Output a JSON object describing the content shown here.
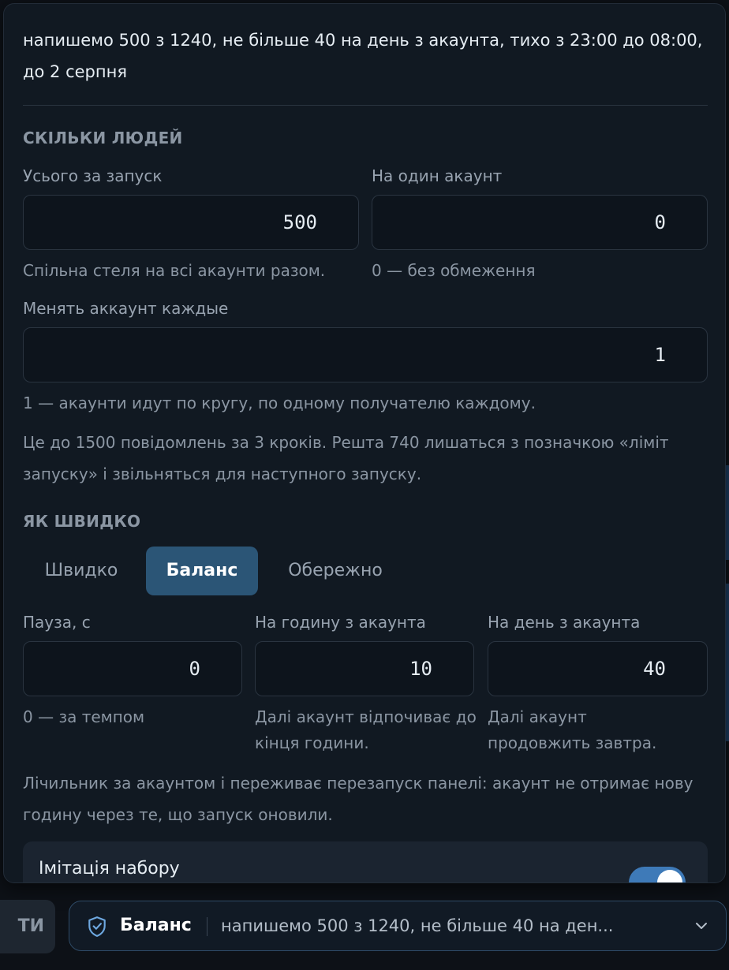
{
  "summary": "напишемо 500 з 1240, не більше 40 на день з акаунта, тихо з 23:00 до 08:00, до 2 серпня",
  "people": {
    "title": "СКІЛЬКИ ЛЮДЕЙ",
    "total_label": "Усього за запуск",
    "total_value": "500",
    "total_hint": "Спільна стеля на всі акаунти разом.",
    "per_account_label": "На один акаунт",
    "per_account_value": "0",
    "per_account_hint": "0 — без обмеження",
    "rotate_label": "Менять аккаунт каждые",
    "rotate_value": "1",
    "rotate_hint": "1 — акаунти идут по кругу, по одному получателю каждому.",
    "note": "Це до 1500 повідомлень за 3 кроків. Решта 740 лишаться з позначкою «ліміт запуску» і звільняться для наступного запуску."
  },
  "speed": {
    "title": "ЯК ШВИДКО",
    "modes": [
      "Швидко",
      "Баланс",
      "Обережно"
    ],
    "active_mode": "Баланс",
    "pause_label": "Пауза, с",
    "pause_value": "0",
    "pause_hint": "0 — за темпом",
    "per_hour_label": "На годину з акаунта",
    "per_hour_value": "10",
    "per_hour_hint": "Далі акаунт відпочиває до кінця години.",
    "per_day_label": "На день з акаунта",
    "per_day_value": "40",
    "per_day_hint": "Далі акаунт продовжить завтра.",
    "note": "Лічильник за акаунтом і переживає перезапуск панелі: акаунт не отримає нову годину через те, що запуск оновили."
  },
  "typing": {
    "label": "Імітація набору",
    "enabled": true
  },
  "bottom_bar": {
    "left_button": "ТИ",
    "mode_name": "Баланс",
    "summary": "напишемо 500 з 1240, не більше 40 на ден..."
  },
  "colors": {
    "panel_bg": "#111922",
    "active_segment": "#2b5576",
    "toggle_on": "#3e7ab8",
    "bar_border": "#2e4a66"
  }
}
